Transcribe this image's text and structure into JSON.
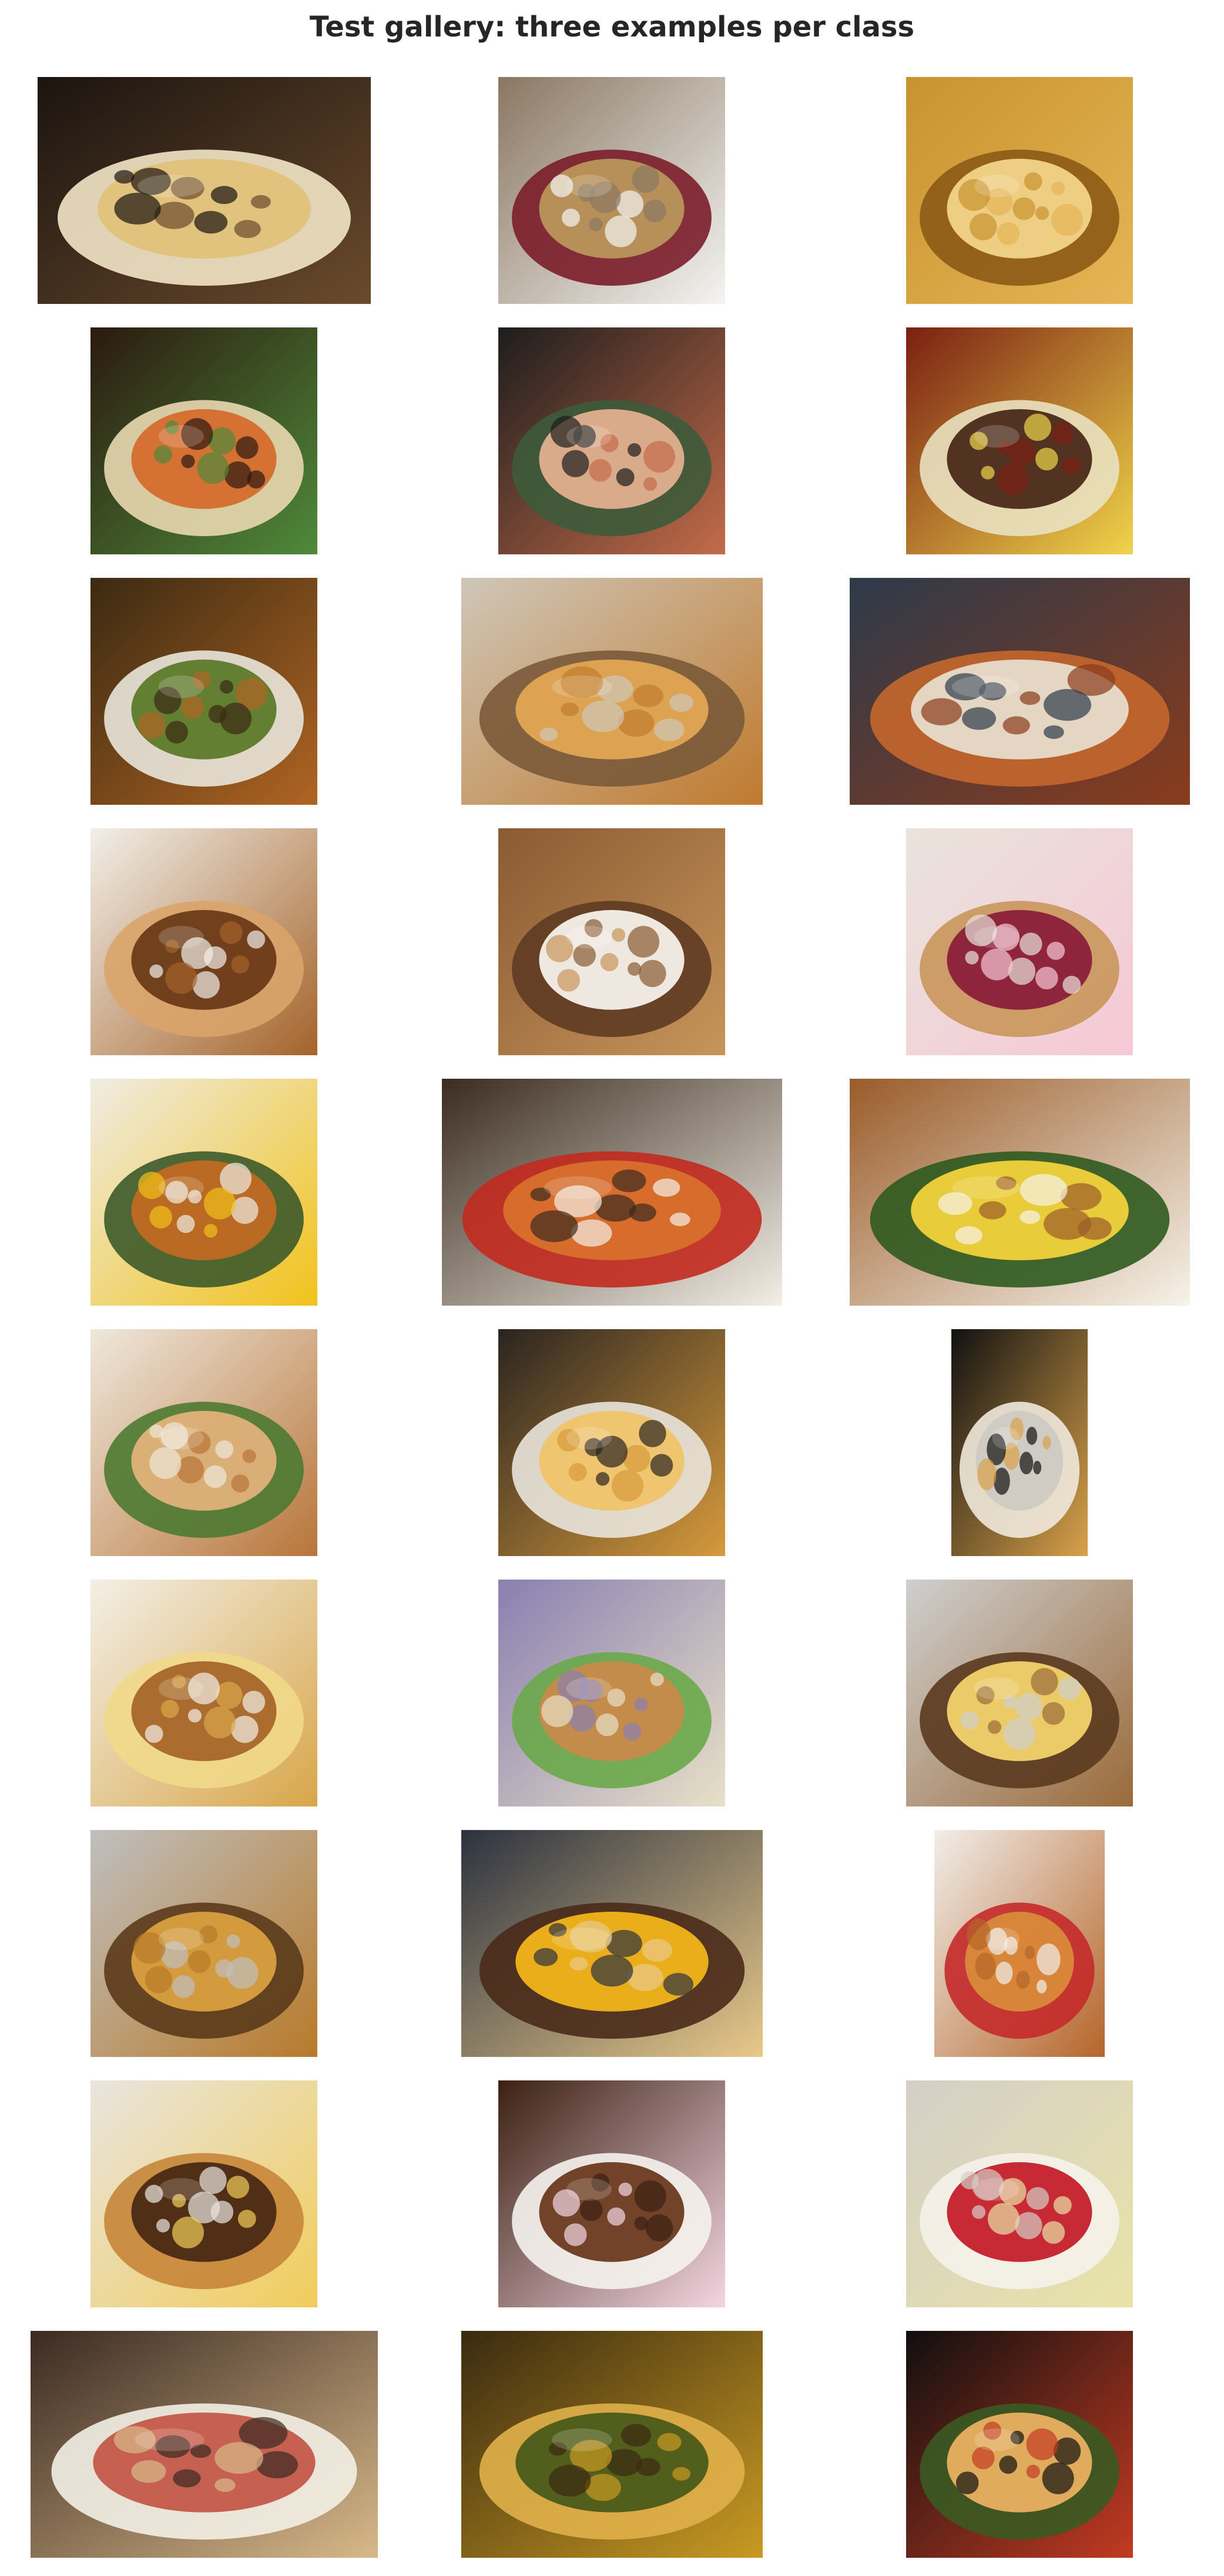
{
  "title": "Test gallery: three examples per class",
  "images": [
    {
      "name": "dessert-pie-icecream-photo",
      "aspect": 1.47,
      "icon": "pie-with-icecream",
      "colors": [
        "#1b1410",
        "#6b4a2c",
        "#e2c27a",
        "#f3e6c6"
      ]
    },
    {
      "name": "plated-dessert-berries-photo",
      "aspect": 1.0,
      "icon": "plate-with-berries",
      "colors": [
        "#8a7762",
        "#f4f4f2",
        "#b9955a",
        "#7b1d2b"
      ]
    },
    {
      "name": "fried-pastry-closeup-photo",
      "aspect": 1.0,
      "icon": "golden-pastry",
      "colors": [
        "#c8932f",
        "#e6b555",
        "#f2d488",
        "#8c5a16"
      ]
    },
    {
      "name": "bibimbap-bowl-photo-1",
      "aspect": 1.0,
      "icon": "mixed-rice-bowl",
      "colors": [
        "#2b1a10",
        "#4f8a3a",
        "#d66b2e",
        "#e9d8b0"
      ]
    },
    {
      "name": "bibimbap-bowl-photo-2",
      "aspect": 1.0,
      "icon": "stone-pot-bowl",
      "colors": [
        "#1d1d1d",
        "#c46b4a",
        "#e3b08e",
        "#3d5b3a"
      ]
    },
    {
      "name": "bibimbap-bowl-photo-3",
      "aspect": 1.0,
      "icon": "mixed-rice-bowl",
      "colors": [
        "#7a1f12",
        "#f0d44a",
        "#4a2a1a",
        "#e9e1c0"
      ]
    },
    {
      "name": "chicken-wings-plate-photo",
      "aspect": 1.0,
      "icon": "wings-with-dip",
      "colors": [
        "#3b2a12",
        "#b06423",
        "#5c7a2a",
        "#e9e6dc"
      ]
    },
    {
      "name": "fried-chicken-basket-photo",
      "aspect": 1.33,
      "icon": "fried-chicken-basket",
      "colors": [
        "#cfc6b8",
        "#c07a2e",
        "#e2a654",
        "#7a5a3a"
      ]
    },
    {
      "name": "fried-chicken-plate-photo",
      "aspect": 1.5,
      "icon": "fried-chicken-plate",
      "colors": [
        "#2d3a4a",
        "#8a3b1c",
        "#e7dccb",
        "#c4672e"
      ]
    },
    {
      "name": "donuts-tray-photo",
      "aspect": 1.0,
      "icon": "donut-pile",
      "colors": [
        "#f2efe9",
        "#a4632a",
        "#6b3a18",
        "#d9a46a"
      ]
    },
    {
      "name": "cinnamon-donut-closeup-photo",
      "aspect": 1.0,
      "icon": "frosted-donut",
      "colors": [
        "#8a5a32",
        "#c7955a",
        "#f5f1ea",
        "#5e3b22"
      ]
    },
    {
      "name": "donut-box-photo",
      "aspect": 1.0,
      "icon": "donut-box",
      "colors": [
        "#e9e3dc",
        "#f6c8d6",
        "#8a1f3a",
        "#c9965b"
      ]
    },
    {
      "name": "eggs-benedict-plate-photo-1",
      "aspect": 1.0,
      "icon": "eggs-benedict",
      "colors": [
        "#f0ece3",
        "#f1c21b",
        "#c06a22",
        "#3d5a2a"
      ]
    },
    {
      "name": "eggs-benedict-plate-photo-2",
      "aspect": 1.5,
      "icon": "eggs-benedict",
      "colors": [
        "#3b2b20",
        "#f3efe5",
        "#d8702d",
        "#c32a1f"
      ]
    },
    {
      "name": "eggs-benedict-plate-photo-3",
      "aspect": 1.5,
      "icon": "eggs-benedict",
      "colors": [
        "#9a5c2a",
        "#f6f3ea",
        "#f2d23a",
        "#2f5a1f"
      ]
    },
    {
      "name": "potato-wedges-photo",
      "aspect": 1.0,
      "icon": "potato-wedges",
      "colors": [
        "#efe8dc",
        "#b8753a",
        "#e1b27a",
        "#4d7a32"
      ]
    },
    {
      "name": "french-fries-box-photo",
      "aspect": 1.0,
      "icon": "fries-pile",
      "colors": [
        "#2a2420",
        "#d79a3c",
        "#f0c46a",
        "#e9e4dc"
      ]
    },
    {
      "name": "fries-cone-photo",
      "aspect": 0.6,
      "icon": "fries-cone",
      "colors": [
        "#111111",
        "#d9a24a",
        "#cfcac3",
        "#efe9dc"
      ]
    },
    {
      "name": "garlic-bread-chips-photo",
      "aspect": 1.0,
      "icon": "toast-and-chips",
      "colors": [
        "#f3efe6",
        "#d8a64a",
        "#a5672a",
        "#f1d98a"
      ]
    },
    {
      "name": "grilled-sandwich-photo-1",
      "aspect": 1.0,
      "icon": "grilled-sandwich",
      "colors": [
        "#8a7fb0",
        "#e8e0c8",
        "#c78a4a",
        "#6aa84a"
      ]
    },
    {
      "name": "grilled-sandwich-foil-photo",
      "aspect": 1.0,
      "icon": "grilled-sandwich",
      "colors": [
        "#cfcfcf",
        "#9a6a3a",
        "#f2d36a",
        "#5a3a1f"
      ]
    },
    {
      "name": "burger-fries-foil-photo",
      "aspect": 1.0,
      "icon": "burger-with-fries",
      "colors": [
        "#bfbfbf",
        "#b87a2a",
        "#d9a040",
        "#5a3a1a"
      ]
    },
    {
      "name": "cheeseburger-closeup-photo",
      "aspect": 1.33,
      "icon": "cheeseburger",
      "colors": [
        "#2c3240",
        "#e9c98a",
        "#f1b51a",
        "#4a2a1a"
      ]
    },
    {
      "name": "burger-onion-rings-photo",
      "aspect": 0.75,
      "icon": "burger-onion-rings",
      "colors": [
        "#f1eeea",
        "#b5652a",
        "#d98a3a",
        "#c42a2a"
      ]
    },
    {
      "name": "icecream-waffle-bowl-photo",
      "aspect": 1.0,
      "icon": "icecream-scoops",
      "colors": [
        "#e9e5df",
        "#f1cc5a",
        "#4a2a14",
        "#c6863a"
      ]
    },
    {
      "name": "soft-serve-cups-photo",
      "aspect": 1.0,
      "icon": "soft-serve-cups",
      "colors": [
        "#3b2012",
        "#f4d6e2",
        "#6b3a1f",
        "#f6f3ee"
      ]
    },
    {
      "name": "gelato-cup-photo",
      "aspect": 1.0,
      "icon": "gelato-cup",
      "colors": [
        "#d4cfc7",
        "#e9e3a8",
        "#c41f2a",
        "#f5f2ea"
      ]
    },
    {
      "name": "prosciutto-pizza-photo",
      "aspect": 1.53,
      "icon": "pizza-round",
      "colors": [
        "#3a2a22",
        "#d9b98a",
        "#c45a4a",
        "#f3efe6"
      ]
    },
    {
      "name": "herb-pizza-closeup-photo",
      "aspect": 1.33,
      "icon": "pizza-round",
      "colors": [
        "#3a2a10",
        "#c99a22",
        "#4a5a1a",
        "#e0b04a"
      ]
    },
    {
      "name": "vegetable-pizza-photo",
      "aspect": 1.0,
      "icon": "pizza-round",
      "colors": [
        "#0f0f0f",
        "#c33a22",
        "#e9b060",
        "#3a5a22"
      ]
    }
  ]
}
